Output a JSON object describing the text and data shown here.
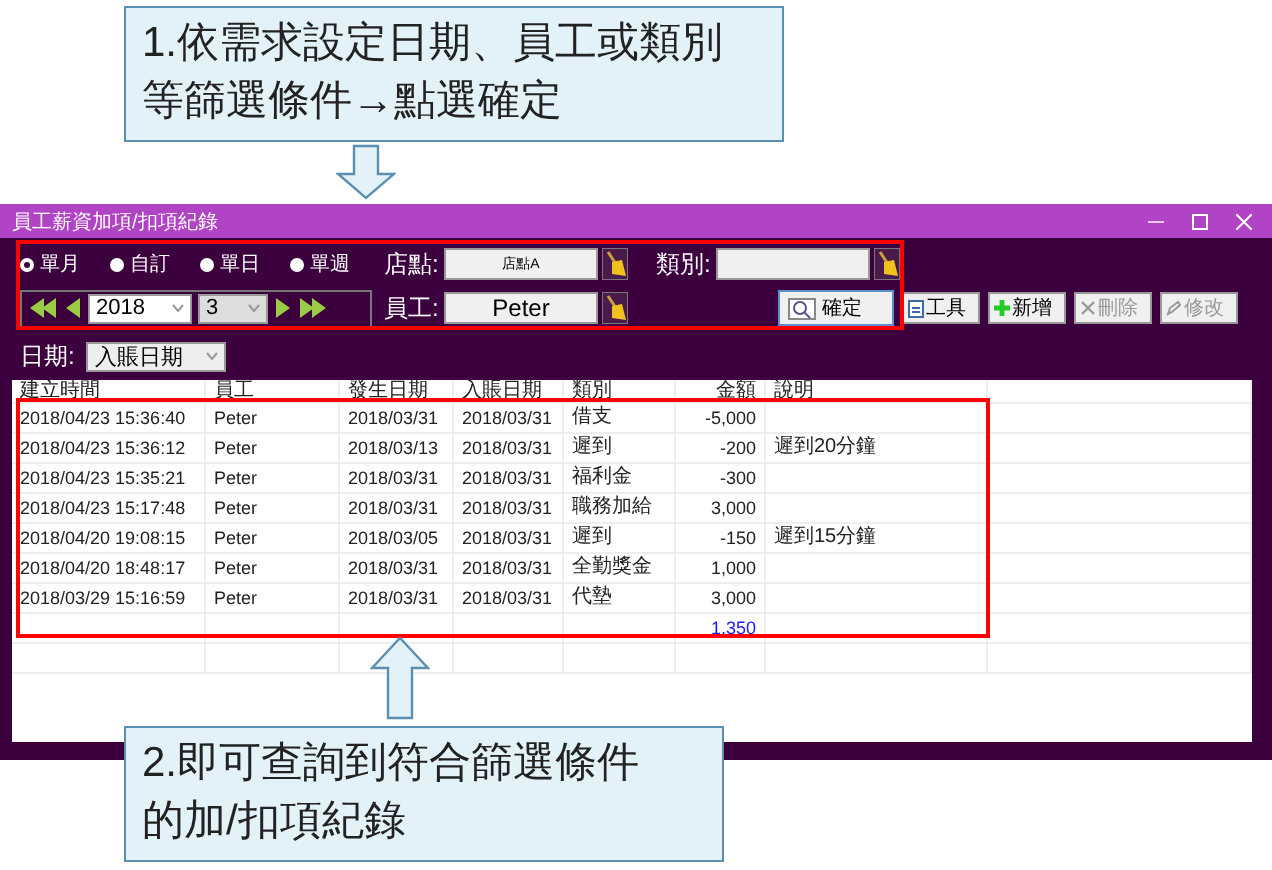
{
  "annotations": [
    {
      "kind": "callout",
      "lines": [
        "1.依需求設定日期、員工或類別",
        "等篩選條件→點選確定"
      ]
    },
    {
      "kind": "callout",
      "lines": [
        "2.即可查詢到符合篩選條件",
        "的加/扣項紀錄"
      ]
    }
  ],
  "window": {
    "title": "員工薪資加項/扣項紀錄"
  },
  "period_options": [
    {
      "label": "單月",
      "selected": true
    },
    {
      "label": "自訂",
      "selected": false
    },
    {
      "label": "單日",
      "selected": false
    },
    {
      "label": "單週",
      "selected": false
    }
  ],
  "year": "2018",
  "month": "3",
  "store": {
    "label": "店點:",
    "value": "店點A"
  },
  "employee": {
    "label": "員工:",
    "value": "Peter"
  },
  "category": {
    "label": "類別:"
  },
  "confirm_button": "確定",
  "toolbar": [
    {
      "label": "工具",
      "kind": "tools",
      "disabled": false
    },
    {
      "label": "新增",
      "kind": "add",
      "disabled": false
    },
    {
      "label": "刪除",
      "kind": "delete",
      "disabled": true
    },
    {
      "label": "修改",
      "kind": "edit",
      "disabled": true
    }
  ],
  "date_filter": {
    "label": "日期:",
    "value": "入賬日期"
  },
  "table": {
    "columns": [
      "建立時間",
      "員工",
      "發生日期",
      "入賬日期",
      "類別",
      "金額",
      "說明"
    ],
    "rows": [
      [
        "2018/04/23 15:36:40",
        "Peter",
        "2018/03/31",
        "2018/03/31",
        "借支",
        "-5,000",
        ""
      ],
      [
        "2018/04/23 15:36:12",
        "Peter",
        "2018/03/13",
        "2018/03/31",
        "遲到",
        "-200",
        "遲到20分鐘"
      ],
      [
        "2018/04/23 15:35:21",
        "Peter",
        "2018/03/31",
        "2018/03/31",
        "福利金",
        "-300",
        ""
      ],
      [
        "2018/04/23 15:17:48",
        "Peter",
        "2018/03/31",
        "2018/03/31",
        "職務加給",
        "3,000",
        ""
      ],
      [
        "2018/04/20 19:08:15",
        "Peter",
        "2018/03/05",
        "2018/03/31",
        "遲到",
        "-150",
        "遲到15分鐘"
      ],
      [
        "2018/04/20 18:48:17",
        "Peter",
        "2018/03/31",
        "2018/03/31",
        "全勤獎金",
        "1,000",
        ""
      ],
      [
        "2018/03/29 15:16:59",
        "Peter",
        "2018/03/31",
        "2018/03/31",
        "代墊",
        "3,000",
        ""
      ]
    ],
    "total": "1,350"
  }
}
